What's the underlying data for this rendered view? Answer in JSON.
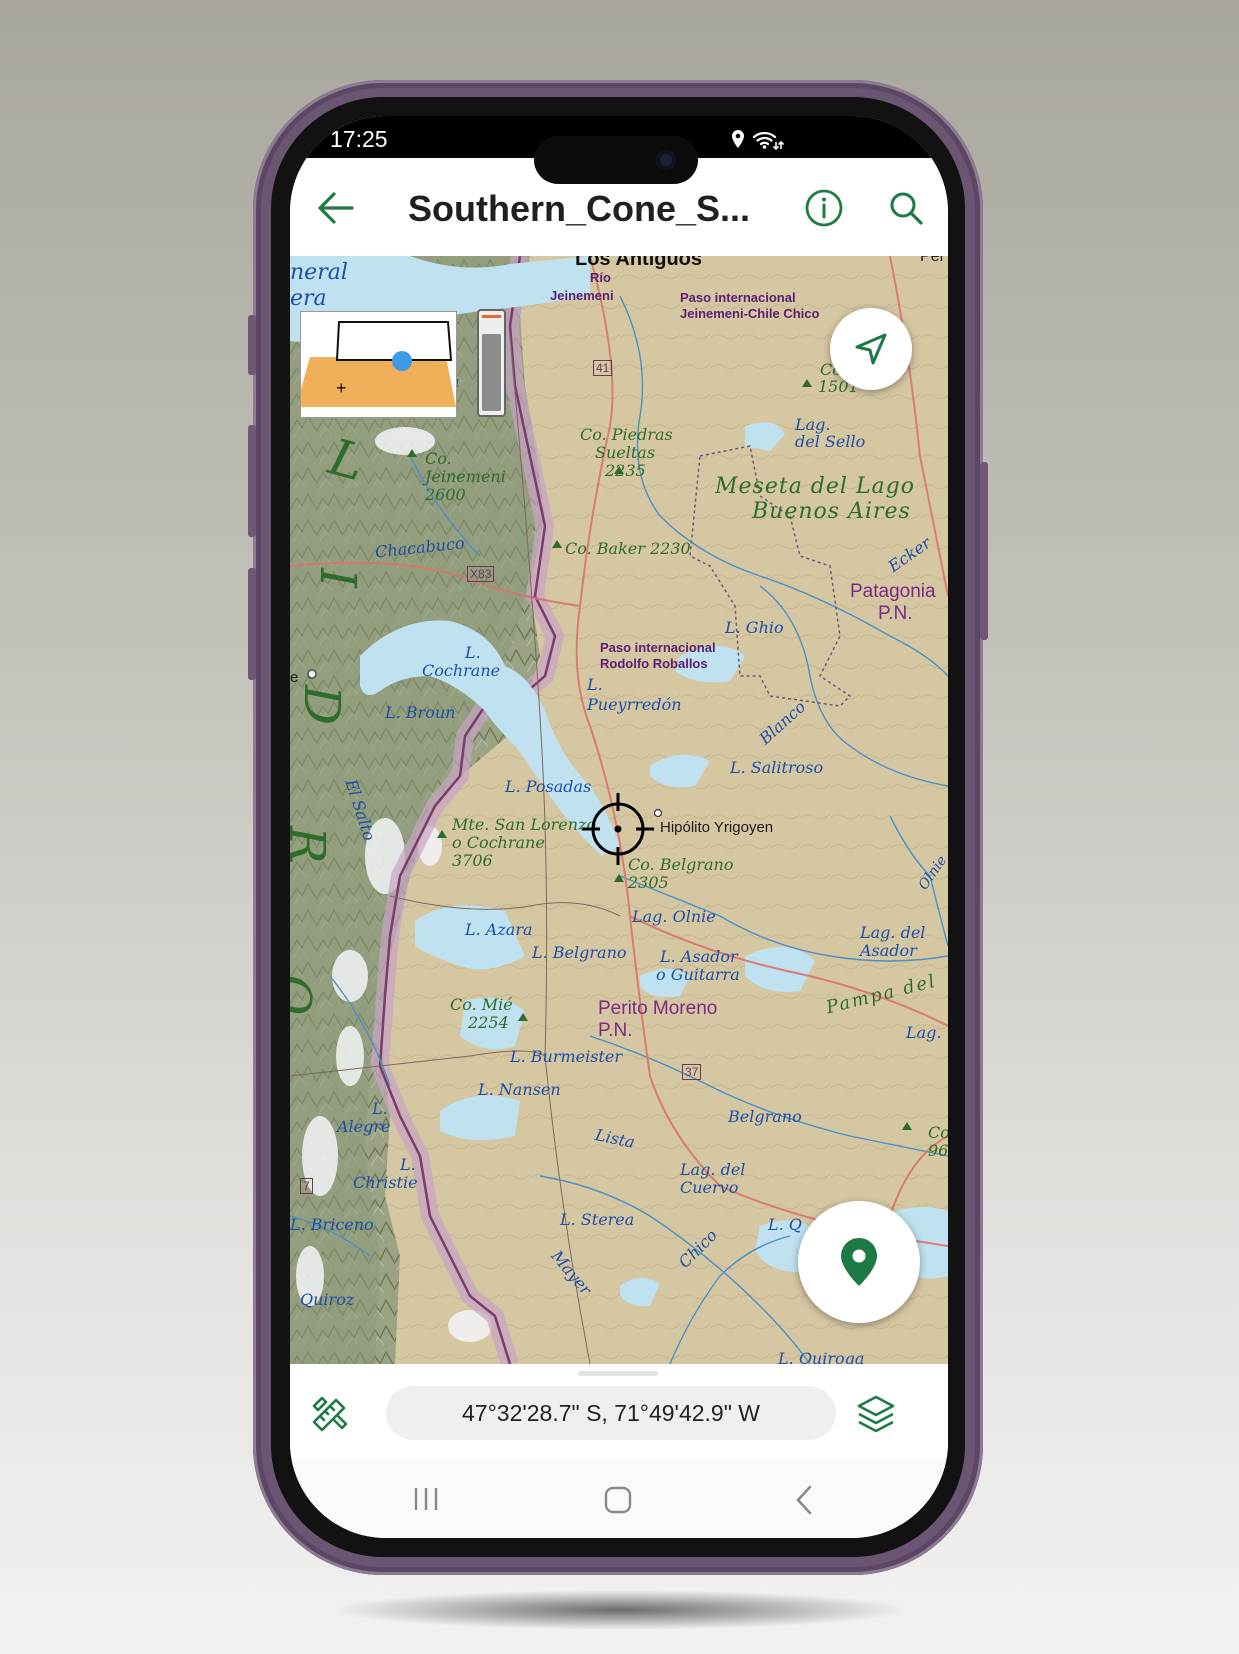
{
  "status_bar": {
    "time": "17:25",
    "icons": [
      "location-icon",
      "wifi-icon"
    ]
  },
  "app_bar": {
    "title": "Southern_Cone_S...",
    "icons": [
      "back-arrow-icon",
      "info-icon",
      "search-icon"
    ],
    "accent_color": "#1e7a45"
  },
  "map": {
    "labels": {
      "los_antiguos": "Los Antiguos",
      "rio": "Río",
      "jeinemeni": "Jeinemeni",
      "paso_jc_1": "Paso internacional",
      "paso_jc_2": "Jeinemeni-Chile Chico",
      "neral": "neral",
      "era": "era",
      "per": "Per",
      "co_1501_a": "Co.",
      "co_1501_b": "1501",
      "route41": "41",
      "lag_sello_1": "Lag.",
      "lag_sello_2": "del Sello",
      "co_piedras_1": "Co. Piedras",
      "co_piedras_2": "Sueltas",
      "co_piedras_3": "2235",
      "meseta_1": "Meseta del Lago",
      "meseta_2": "Buenos Aires",
      "co_jeinemeni_1": "Co.",
      "co_jeinemeni_2": "Jeinemeni",
      "co_jeinemeni_3": "2600",
      "co_baker": "Co. Baker 2230",
      "chacabuco": "Chacabuco",
      "x83": "X83",
      "ecker": "Ecker",
      "patagonia_1": "Patagonia",
      "patagonia_2": "P.N.",
      "l_ghio": "L. Ghio",
      "paso_rr_1": "Paso internacional",
      "paso_rr_2": "Rodolfo Roballos",
      "l_cochrane_1": "L.",
      "l_cochrane_2": "Cochrane",
      "l_pueyrredon_1": "L.",
      "l_pueyrredon_2": "Pueyrredón",
      "l_broun": "L. Broun",
      "blanco": "Blanco",
      "l_salitroso": "L. Salitroso",
      "l_posadas": "L. Posadas",
      "hipolito": "Hipólito Yrigoyen",
      "el_salto": "El Salto",
      "mte_sl_1": "Mte. San Lorenzo",
      "mte_sl_2": "o Cochrane",
      "mte_sl_3": "3706",
      "co_belgrano_1": "Co. Belgrano",
      "co_belgrano_2": "2305",
      "lag_olnie": "Lag. Olnie",
      "olnie": "Olnie",
      "l_azara": "L. Azara",
      "lag_asador_1": "Lag. del",
      "lag_asador_2": "Asador",
      "l_belgrano": "L. Belgrano",
      "l_asador_1": "L. Asador",
      "l_asador_2": "o Guitarra",
      "co_mie_1": "Co. Mié",
      "co_mie_2": "2254",
      "perito_1": "Perito Moreno",
      "perito_2": "P.N.",
      "pampa": "Pampa del",
      "lag_right": "Lag.",
      "l_burmeister": "L. Burmeister",
      "route37": "37",
      "l_nansen": "L. Nansen",
      "l_alegre_1": "L.",
      "l_alegre_2": "Alegre",
      "belgrano_river": "Belgrano",
      "lista": "Lista",
      "co_right_1": "Co",
      "co_right_2": "96",
      "l_christie_1": "L.",
      "l_christie_2": "Christie",
      "lag_cuervo_1": "Lag. del",
      "lag_cuervo_2": "Cuervo",
      "route7": "7",
      "l_briceno": "L. Briceno",
      "l_sterea": "L. Sterea",
      "l_q": "L. Q",
      "chico": "Chico",
      "mayer": "Mayer",
      "quiroz": "Quiroz",
      "l_quiroga": "L. Quiroga",
      "cordillera_letters": [
        "L",
        "I",
        "D",
        "R",
        "O"
      ],
      "e_edge": "e",
      "a_edge": "a"
    },
    "crosshair_icon": "crosshair-icon",
    "zoom_level": 0.8
  },
  "controls": {
    "locate_icon": "navigation-arrow-icon",
    "add_marker_icon": "map-pin-icon",
    "minimap_icon": "tilt-minimap-icon"
  },
  "bottom_bar": {
    "coordinates": "47°32'28.7\" S, 71°49'42.9\" W",
    "left_icon": "ruler-pencil-icon",
    "right_icon": "layers-icon"
  },
  "nav_bar": {
    "icons": [
      "recent-apps-icon",
      "home-icon",
      "back-icon"
    ]
  }
}
